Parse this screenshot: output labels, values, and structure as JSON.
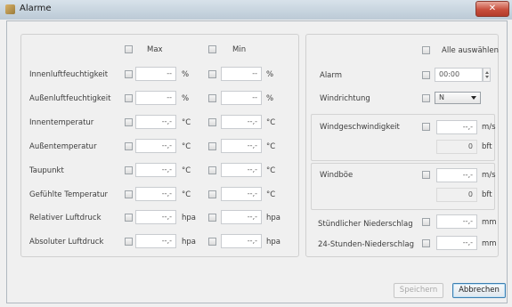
{
  "window": {
    "title": "Alarme",
    "close_glyph": "✕"
  },
  "left_panel": {
    "col_max": "Max",
    "col_min": "Min",
    "rows": [
      {
        "label": "Innenluftfeuchtigkeit",
        "max_value": "--",
        "max_unit": "%",
        "min_value": "--",
        "min_unit": "%"
      },
      {
        "label": "Außenluftfeuchtigkeit",
        "max_value": "--",
        "max_unit": "%",
        "min_value": "--",
        "min_unit": "%"
      },
      {
        "label": "Innentemperatur",
        "max_value": "--,-",
        "max_unit": "°C",
        "min_value": "--,-",
        "min_unit": "°C"
      },
      {
        "label": "Außentemperatur",
        "max_value": "--,-",
        "max_unit": "°C",
        "min_value": "--,-",
        "min_unit": "°C"
      },
      {
        "label": "Taupunkt",
        "max_value": "--,-",
        "max_unit": "°C",
        "min_value": "--,-",
        "min_unit": "°C"
      },
      {
        "label": "Gefühlte Temperatur",
        "max_value": "--,-",
        "max_unit": "°C",
        "min_value": "--,-",
        "min_unit": "°C"
      },
      {
        "label": "Relativer Luftdruck",
        "max_value": "--,-",
        "max_unit": "hpa",
        "min_value": "--,-",
        "min_unit": "hpa"
      },
      {
        "label": "Absoluter Luftdruck",
        "max_value": "--,-",
        "max_unit": "hpa",
        "min_value": "--,-",
        "min_unit": "hpa"
      }
    ]
  },
  "right_panel": {
    "select_all": "Alle auswählen",
    "alarm": {
      "label": "Alarm",
      "value": "00:00"
    },
    "wind_direction": {
      "label": "Windrichtung",
      "value": "N"
    },
    "wind_speed": {
      "label": "Windgeschwindigkeit",
      "value": "--,-",
      "unit": "m/s",
      "bft_value": "0",
      "bft_unit": "bft"
    },
    "gust": {
      "label": "Windböe",
      "value": "--,-",
      "unit": "m/s",
      "bft_value": "0",
      "bft_unit": "bft"
    },
    "rain_hourly": {
      "label": "Stündlicher Niederschlag",
      "value": "--,-",
      "unit": "mm"
    },
    "rain_24h": {
      "label": "24-Stunden-Niederschlag",
      "value": "--,-",
      "unit": "mm"
    }
  },
  "footer": {
    "save_label": "Speichern",
    "cancel_label": "Abbrechen"
  }
}
